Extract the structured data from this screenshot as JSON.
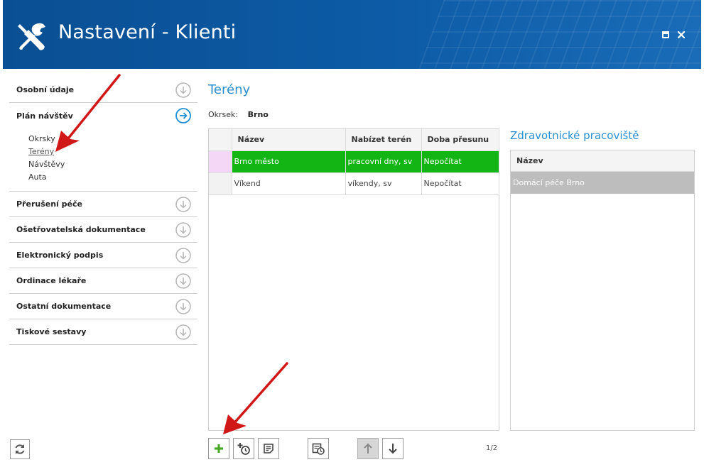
{
  "window": {
    "title": "Nastavení - Klienti"
  },
  "nav": {
    "items": [
      {
        "label": "Osobní údaje"
      },
      {
        "label": "Plán návštěv",
        "expanded": true,
        "subitems": [
          {
            "label": "Okrsky"
          },
          {
            "label": "Terény",
            "active": true
          },
          {
            "label": "Návštěvy"
          },
          {
            "label": "Auta"
          }
        ]
      },
      {
        "label": "Přerušení péče"
      },
      {
        "label": "Ošetřovatelská dokumentace"
      },
      {
        "label": "Elektronický podpis"
      },
      {
        "label": "Ordinace lékaře"
      },
      {
        "label": "Ostatní dokumentace"
      },
      {
        "label": "Tiskové sestavy"
      }
    ]
  },
  "main": {
    "title": "Terény",
    "district_label": "Okrsek:",
    "district_value": "Brno",
    "table": {
      "columns": [
        "Název",
        "Nabízet terén",
        "Doba přesunu"
      ],
      "rows": [
        {
          "cells": [
            "Brno město",
            "pracovní dny, sv",
            "Nepočítat"
          ],
          "selected": true
        },
        {
          "cells": [
            "Víkend",
            "víkendy, sv",
            "Nepočítat"
          ],
          "selected": false
        }
      ]
    },
    "pagination": "1/2"
  },
  "side": {
    "title": "Zdravotnické pracoviště",
    "column": "Název",
    "rows": [
      "Domácí péče Brno"
    ]
  },
  "icons": {
    "app": "tools-icon",
    "maximize": "maximize-icon",
    "close": "close-icon",
    "collapsed": "arrow-down-circle-icon",
    "expanded": "arrow-right-circle-icon",
    "refresh": "refresh-icon",
    "add": "plus-icon",
    "add_time": "add-time-icon",
    "note": "note-icon",
    "schedule": "calendar-clock-icon",
    "up": "arrow-up-icon",
    "down": "arrow-down-icon"
  },
  "colors": {
    "header": "#0d5ba6",
    "accent": "#2a8fd0",
    "selected_row": "#13b514",
    "indicator": "#f4d7f6",
    "add_icon": "#4aa82a",
    "annotation": "#d01818"
  }
}
